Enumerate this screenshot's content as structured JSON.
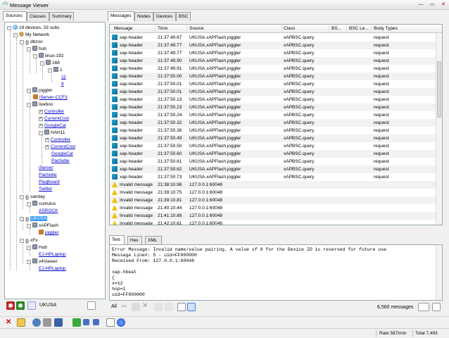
{
  "window": {
    "title": "Message Viewer",
    "logo": "xfx",
    "min": "—",
    "max": "▭",
    "close": "✕"
  },
  "left_tabs": [
    "Sources",
    "Classes",
    "Summary"
  ],
  "right_tabs": [
    "Messages",
    "Nodes",
    "Devices",
    "BSC"
  ],
  "tree": {
    "root": "18 devices, 33 subs",
    "my_network": "My Network",
    "dbzoo": "dbzoo",
    "hub": "hub",
    "linux": "linux-192",
    "n168": "168",
    "n1": "1",
    "n11": "11",
    "n9": "9",
    "joggler": "joggler",
    "iserver_ccf3": "iServer-CCF3",
    "livebox": "livebox",
    "controller": "Controller",
    "currentcost": "CurrentCost",
    "googlecal": "GoogleCal",
    "hah11": "HAH11",
    "hah_controller": "Controller",
    "hah_currentcost": "CurrentCost",
    "hah_googlecal": "GoogleCal",
    "hah_pachube": "Pachube",
    "iserver": "iServer",
    "pachube": "Pachube",
    "plugboard": "Plugboard",
    "twitter": "Twitter",
    "sanday": "sanday",
    "cumulus": "cumulus",
    "asrock": "ASROCK",
    "ukusa": "UKUSA",
    "xapflash": "xAPFlash",
    "joggler2": "joggler",
    "xfx": "xFx",
    "hub2": "Hub",
    "ejhp1": "EJ-HPLaptop",
    "v4viewer": "v4Viewer",
    "ejhp2": "EJ-HPLaptop"
  },
  "left_filter": "UKUSA",
  "grid": {
    "headers": [
      "Message",
      "Time",
      "Source",
      "Class",
      "BS...",
      "BSC Le...",
      "Body Types"
    ],
    "rows": [
      {
        "icon": "xap",
        "msg": "xap-header",
        "time": "21:37:49.67",
        "src": "UKUSA.xAPFlash.joggler",
        "cls": "xAPBSC.query",
        "body": "request"
      },
      {
        "icon": "xap",
        "msg": "xap-header",
        "time": "21:37:49.77",
        "src": "UKUSA.xAPFlash.joggler",
        "cls": "xAPBSC.query",
        "body": "request"
      },
      {
        "icon": "xap",
        "msg": "xap-header",
        "time": "21:37:49.77",
        "src": "UKUSA.xAPFlash.joggler",
        "cls": "xAPBSC.query",
        "body": "request"
      },
      {
        "icon": "xap",
        "msg": "xap-header",
        "time": "21:37:49.90",
        "src": "UKUSA.xAPFlash.joggler",
        "cls": "xAPBSC.query",
        "body": "request"
      },
      {
        "icon": "xap",
        "msg": "xap-header",
        "time": "21:37:49.91",
        "src": "UKUSA.xAPFlash.joggler",
        "cls": "xAPBSC.query",
        "body": "request"
      },
      {
        "icon": "xap",
        "msg": "xap-header",
        "time": "21:37:50.00",
        "src": "UKUSA.xAPFlash.joggler",
        "cls": "xAPBSC.query",
        "body": "request"
      },
      {
        "icon": "xap",
        "msg": "xap-header",
        "time": "21:37:50.01",
        "src": "UKUSA.xAPFlash.joggler",
        "cls": "xAPBSC.query",
        "body": "request"
      },
      {
        "icon": "xap",
        "msg": "xap-header",
        "time": "21:37:50.01",
        "src": "UKUSA.xAPFlash.joggler",
        "cls": "xAPBSC.query",
        "body": "request"
      },
      {
        "icon": "xap",
        "msg": "xap-header",
        "time": "21:37:50.13",
        "src": "UKUSA.xAPFlash.joggler",
        "cls": "xAPBSC.query",
        "body": "request"
      },
      {
        "icon": "xap",
        "msg": "xap-header",
        "time": "21:37:50.23",
        "src": "UKUSA.xAPFlash.joggler",
        "cls": "xAPBSC.query",
        "body": "request"
      },
      {
        "icon": "xap",
        "msg": "xap-header",
        "time": "21:37:50.24",
        "src": "UKUSA.xAPFlash.joggler",
        "cls": "xAPBSC.query",
        "body": "request"
      },
      {
        "icon": "xap",
        "msg": "xap-header",
        "time": "21:37:50.32",
        "src": "UKUSA.xAPFlash.joggler",
        "cls": "xAPBSC.query",
        "body": "request"
      },
      {
        "icon": "xap",
        "msg": "xap-header",
        "time": "21:37:50.36",
        "src": "UKUSA.xAPFlash.joggler",
        "cls": "xAPBSC.query",
        "body": "request"
      },
      {
        "icon": "xap",
        "msg": "xap-header",
        "time": "21:37:50.49",
        "src": "UKUSA.xAPFlash.joggler",
        "cls": "xAPBSC.query",
        "body": "request"
      },
      {
        "icon": "xap",
        "msg": "xap-header",
        "time": "21:37:50.50",
        "src": "UKUSA.xAPFlash.joggler",
        "cls": "xAPBSC.query",
        "body": "request"
      },
      {
        "icon": "xap",
        "msg": "xap-header",
        "time": "21:37:50.60",
        "src": "UKUSA.xAPFlash.joggler",
        "cls": "xAPBSC.query",
        "body": "request"
      },
      {
        "icon": "xap",
        "msg": "xap-header",
        "time": "21:37:50.61",
        "src": "UKUSA.xAPFlash.joggler",
        "cls": "xAPBSC.query",
        "body": "request"
      },
      {
        "icon": "xap",
        "msg": "xap-header",
        "time": "21:37:50.62",
        "src": "UKUSA.xAPFlash.joggler",
        "cls": "xAPBSC.query",
        "body": "request"
      },
      {
        "icon": "xap",
        "msg": "xap-header",
        "time": "21:37:50.73",
        "src": "UKUSA.xAPFlash.joggler",
        "cls": "xAPBSC.query",
        "body": "request"
      },
      {
        "icon": "warn",
        "msg": "Invalid message",
        "time": "21:38:10.96",
        "src": "127.0.0.1:60048",
        "cls": "",
        "body": ""
      },
      {
        "icon": "warn",
        "msg": "Invalid message",
        "time": "21:39:10.75",
        "src": "127.0.0.1:60048",
        "cls": "",
        "body": ""
      },
      {
        "icon": "warn",
        "msg": "Invalid message",
        "time": "21:39:10.81",
        "src": "127.0.0.1:60048",
        "cls": "",
        "body": ""
      },
      {
        "icon": "warn",
        "msg": "Invalid message",
        "time": "21:40:10.44",
        "src": "127.0.0.1:60048",
        "cls": "",
        "body": ""
      },
      {
        "icon": "warn",
        "msg": "Invalid message",
        "time": "21:41:10.88",
        "src": "127.0.0.1:60048",
        "cls": "",
        "body": ""
      },
      {
        "icon": "warn",
        "msg": "Invalid message",
        "time": "21:42:10.61",
        "src": "127.0.0.1:60048",
        "cls": "",
        "body": ""
      }
    ]
  },
  "detail_tabs": [
    "Text",
    "Hex",
    "XML"
  ],
  "detail_lines": [
    "Error Message: Invalid name/value pairing. A value of 0 for the Device ID is reserved for future use",
    "Message Line#: 5 - uid=FF000000",
    "Received From: 127.0.0.1:60048",
    "",
    "xap-hbeat",
    "{",
    "v=12",
    "hop=1",
    "uid=FF000000"
  ],
  "rbar": {
    "all": "All",
    "count": "6,560 messages"
  },
  "status": {
    "rate": "Rate 587/min",
    "total": "Total 7,493"
  }
}
